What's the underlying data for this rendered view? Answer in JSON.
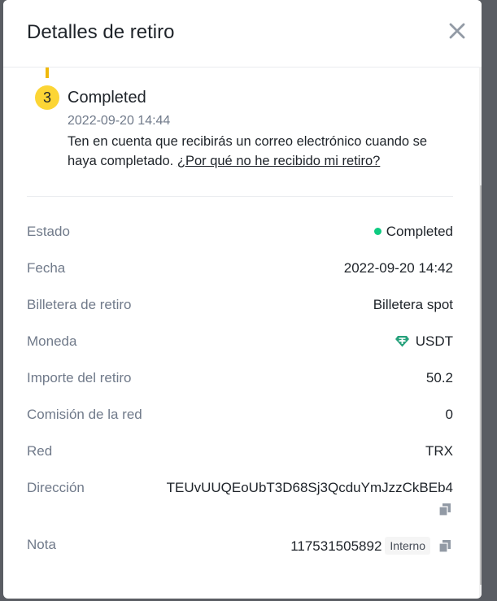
{
  "dialog": {
    "title": "Detalles de retiro"
  },
  "step": {
    "number": "3",
    "title": "Completed",
    "time": "2022-09-20 14:44",
    "desc_text": "Ten en cuenta que recibirás un correo electrónico cuando se haya completado.",
    "desc_link": "¿Por qué no he recibido mi retiro?"
  },
  "details": {
    "estado_label": "Estado",
    "estado_value": "Completed",
    "fecha_label": "Fecha",
    "fecha_value": "2022-09-20 14:42",
    "billetera_label": "Billetera de retiro",
    "billetera_value": "Billetera spot",
    "moneda_label": "Moneda",
    "moneda_value": "USDT",
    "importe_label": "Importe del retiro",
    "importe_value": "50.2",
    "comision_label": "Comisión de la red",
    "comision_value": "0",
    "red_label": "Red",
    "red_value": "TRX",
    "direccion_label": "Dirección",
    "direccion_value": "TEUvUUQEoUbT3D68Sj3QcduYmJzzCkBEb4",
    "nota_label": "Nota",
    "nota_value": "117531505892",
    "nota_tag": "Interno"
  },
  "colors": {
    "accent": "#fcd535",
    "success": "#0ecb81",
    "tether": "#26a17b"
  },
  "icons": {
    "close": "close-icon",
    "copy": "copy-icon",
    "coin": "tether-icon"
  }
}
